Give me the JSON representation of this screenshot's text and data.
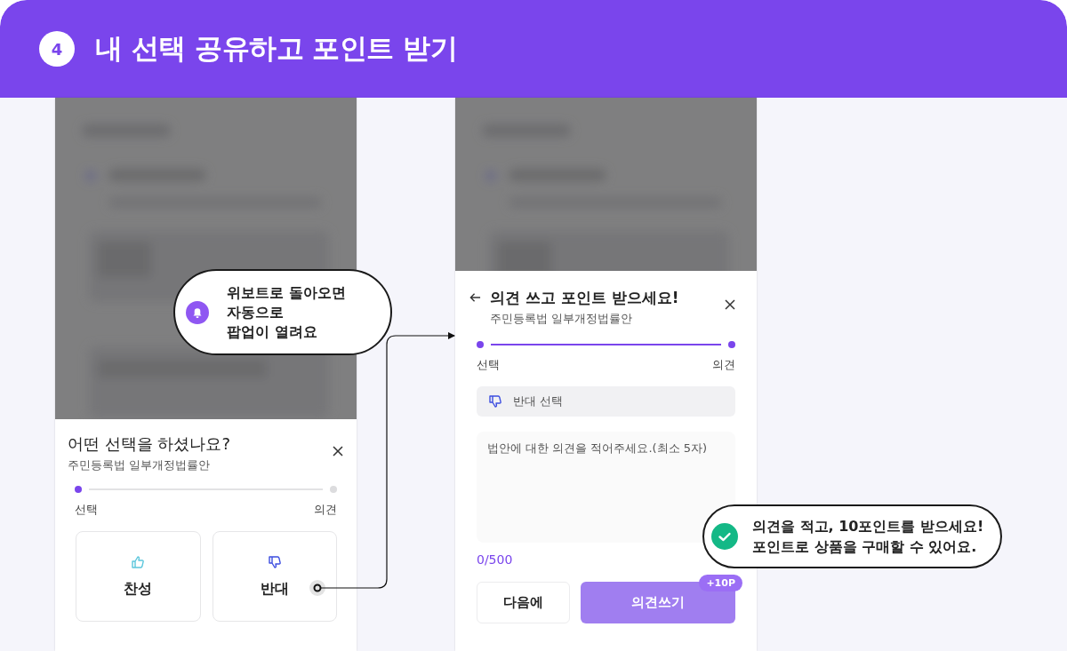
{
  "header": {
    "step_number": "4",
    "title": "내 선택 공유하고 포인트 받기"
  },
  "choice_sheet": {
    "title": "어떤 선택을 하셨나요?",
    "subtitle": "주민등록법 일부개정법률안",
    "steps": [
      {
        "label": "선택",
        "done": true
      },
      {
        "label": "의견",
        "done": false
      }
    ],
    "options": [
      {
        "label": "찬성",
        "kind": "agree"
      },
      {
        "label": "반대",
        "kind": "disagree"
      }
    ]
  },
  "opinion_sheet": {
    "title": "의견 쓰고 포인트 받으세요!",
    "subtitle": "주민등록법 일부개정법률안",
    "steps": [
      {
        "label": "선택",
        "done": true
      },
      {
        "label": "의견",
        "done": true
      }
    ],
    "choice_chip": {
      "label": "반대 선택",
      "kind": "disagree"
    },
    "opinion_field": {
      "placeholder": "법안에 대한 의견을 적어주세요.(최소 5자)",
      "counter": "0/500"
    },
    "buttons": [
      {
        "label": "다음에",
        "kind": "secondary"
      },
      {
        "label": "의견쓰기",
        "kind": "primary",
        "badge": "+10P"
      }
    ]
  },
  "callouts": [
    {
      "kind": "bell",
      "text": "위보트로 돌아오면\n자동으로\n팝업이 열려요"
    },
    {
      "kind": "check",
      "text": "의견을 적고, 10포인트를 받으세요!\n포인트로 상품을 구매할 수 있어요."
    }
  ]
}
